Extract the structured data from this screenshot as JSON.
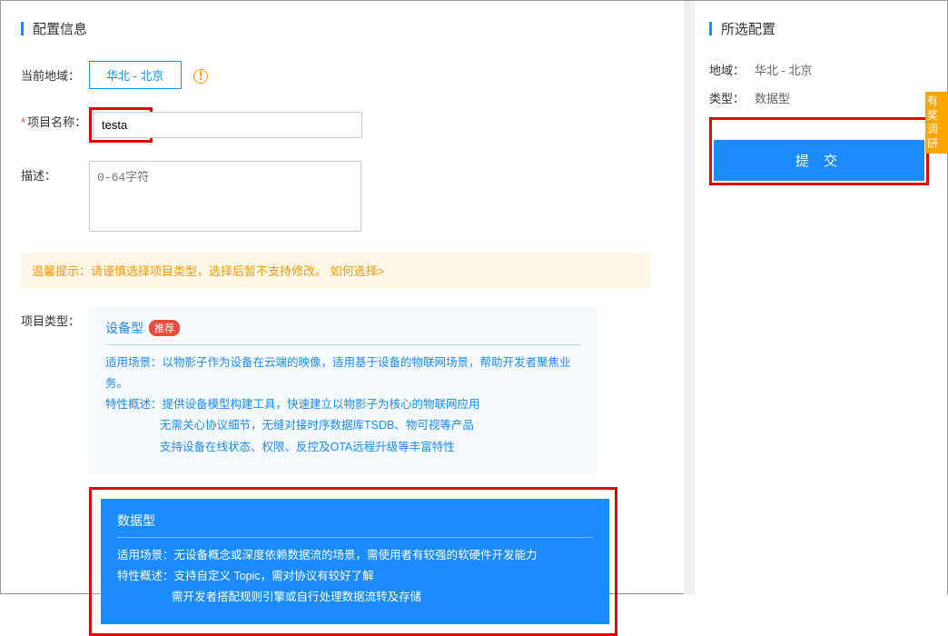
{
  "main": {
    "section_title": "配置信息",
    "region_label": "当前地域：",
    "region_value": "华北 - 北京",
    "name_label": "项目名称：",
    "name_value": "testa",
    "desc_label": "描述：",
    "desc_placeholder": "0-64字符",
    "tip_text": "温馨提示：请谨慎选择项目类型，选择后暂不支持修改。",
    "tip_link": "如何选择>",
    "type_label": "项目类型：",
    "device_card": {
      "title": "设备型",
      "badge": "推荐",
      "line1": "适用场景：以物影子作为设备在云端的映像，适用基于设备的物联网场景，帮助开发者聚焦业务。",
      "line2": "特性概述：提供设备模型构建工具，快速建立以物影子为核心的物联网应用",
      "line3": "无需关心协议细节，无缝对接时序数据库TSDB、物可视等产品",
      "line4": "支持设备在线状态、权限、反控及OTA远程升级等丰富特性"
    },
    "data_card": {
      "title": "数据型",
      "line1": "适用场景：无设备概念或深度依赖数据流的场景，需使用者有较强的软硬件开发能力",
      "line2": "特性概述：支持自定义 Topic，需对协议有较好了解",
      "line3": "需开发者搭配规则引擎或自行处理数据流转及存储"
    }
  },
  "side": {
    "section_title": "所选配置",
    "region_k": "地域：",
    "region_v": "华北 - 北京",
    "type_k": "类型：",
    "type_v": "数据型",
    "submit": "提 交"
  },
  "sticker": "有奖调研"
}
